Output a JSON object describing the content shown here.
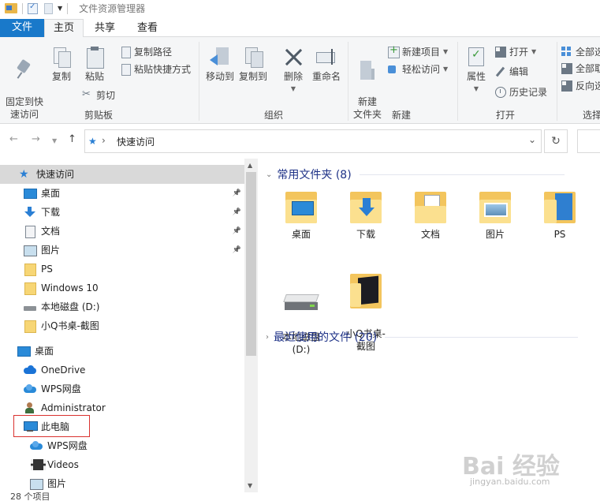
{
  "window": {
    "title": "文件资源管理器"
  },
  "tabs": {
    "file": "文件",
    "home": "主页",
    "share": "共享",
    "view": "查看"
  },
  "ribbon": {
    "clipboard": {
      "label": "剪贴板",
      "pin_quick": "固定到快\n速访问",
      "copy": "复制",
      "paste": "粘贴",
      "copy_path": "复制路径",
      "paste_shortcut": "粘贴快捷方式",
      "cut": "剪切"
    },
    "organize": {
      "label": "组织",
      "move_to": "移动到",
      "copy_to": "复制到",
      "delete": "删除",
      "rename": "重命名"
    },
    "new": {
      "label": "新建",
      "new_folder": "新建\n文件夹",
      "new_item": "新建项目",
      "easy_access": "轻松访问"
    },
    "open": {
      "label": "打开",
      "properties": "属性",
      "open": "打开",
      "edit": "编辑",
      "history": "历史记录"
    },
    "select": {
      "label": "选择",
      "select_all": "全部选",
      "select_none": "全部取",
      "invert": "反向选"
    }
  },
  "address": {
    "path": "快速访问"
  },
  "nav": {
    "items": [
      {
        "label": "快速访问",
        "icon": "quick-access-star-icon",
        "pinned": false,
        "selected": true
      },
      {
        "label": "桌面",
        "icon": "desktop-icon",
        "pinned": true
      },
      {
        "label": "下载",
        "icon": "download-icon",
        "pinned": true
      },
      {
        "label": "文档",
        "icon": "documents-icon",
        "pinned": true
      },
      {
        "label": "图片",
        "icon": "pictures-icon",
        "pinned": true
      },
      {
        "label": "PS",
        "icon": "folder-icon",
        "pinned": false
      },
      {
        "label": "Windows 10",
        "icon": "folder-icon",
        "pinned": false
      },
      {
        "label": "本地磁盘 (D:)",
        "icon": "drive-icon",
        "pinned": false
      },
      {
        "label": "小Q书桌-截图",
        "icon": "folder-icon",
        "pinned": false
      },
      {
        "label": "桌面",
        "icon": "desktop-icon",
        "pinned": false
      },
      {
        "label": "OneDrive",
        "icon": "onedrive-cloud-icon",
        "pinned": false
      },
      {
        "label": "WPS网盘",
        "icon": "wps-cloud-icon",
        "pinned": false
      },
      {
        "label": "Administrator",
        "icon": "user-icon",
        "pinned": false
      },
      {
        "label": "此电脑",
        "icon": "this-pc-icon",
        "pinned": false
      },
      {
        "label": "WPS网盘",
        "icon": "wps-cloud-icon",
        "pinned": false
      },
      {
        "label": "Videos",
        "icon": "videos-icon",
        "pinned": false
      },
      {
        "label": "图片",
        "icon": "pictures-icon",
        "pinned": false
      }
    ]
  },
  "content": {
    "frequent_header": "常用文件夹 (8)",
    "recent_header": "最近使用的文件 (20)",
    "tiles": [
      {
        "label": "桌面"
      },
      {
        "label": "下载"
      },
      {
        "label": "文档"
      },
      {
        "label": "图片"
      },
      {
        "label": "PS"
      },
      {
        "label": "本地磁盘\n(D:)"
      },
      {
        "label": "小Q书桌-\n截图"
      }
    ]
  },
  "status": {
    "item_count": "28 个项目"
  },
  "watermark": {
    "main": "Bai 经验",
    "sub": "jingyan.baidu.com"
  },
  "colors": {
    "accent": "#1979ca",
    "highlight_box": "#d9322f",
    "section_header": "#1e3287"
  }
}
